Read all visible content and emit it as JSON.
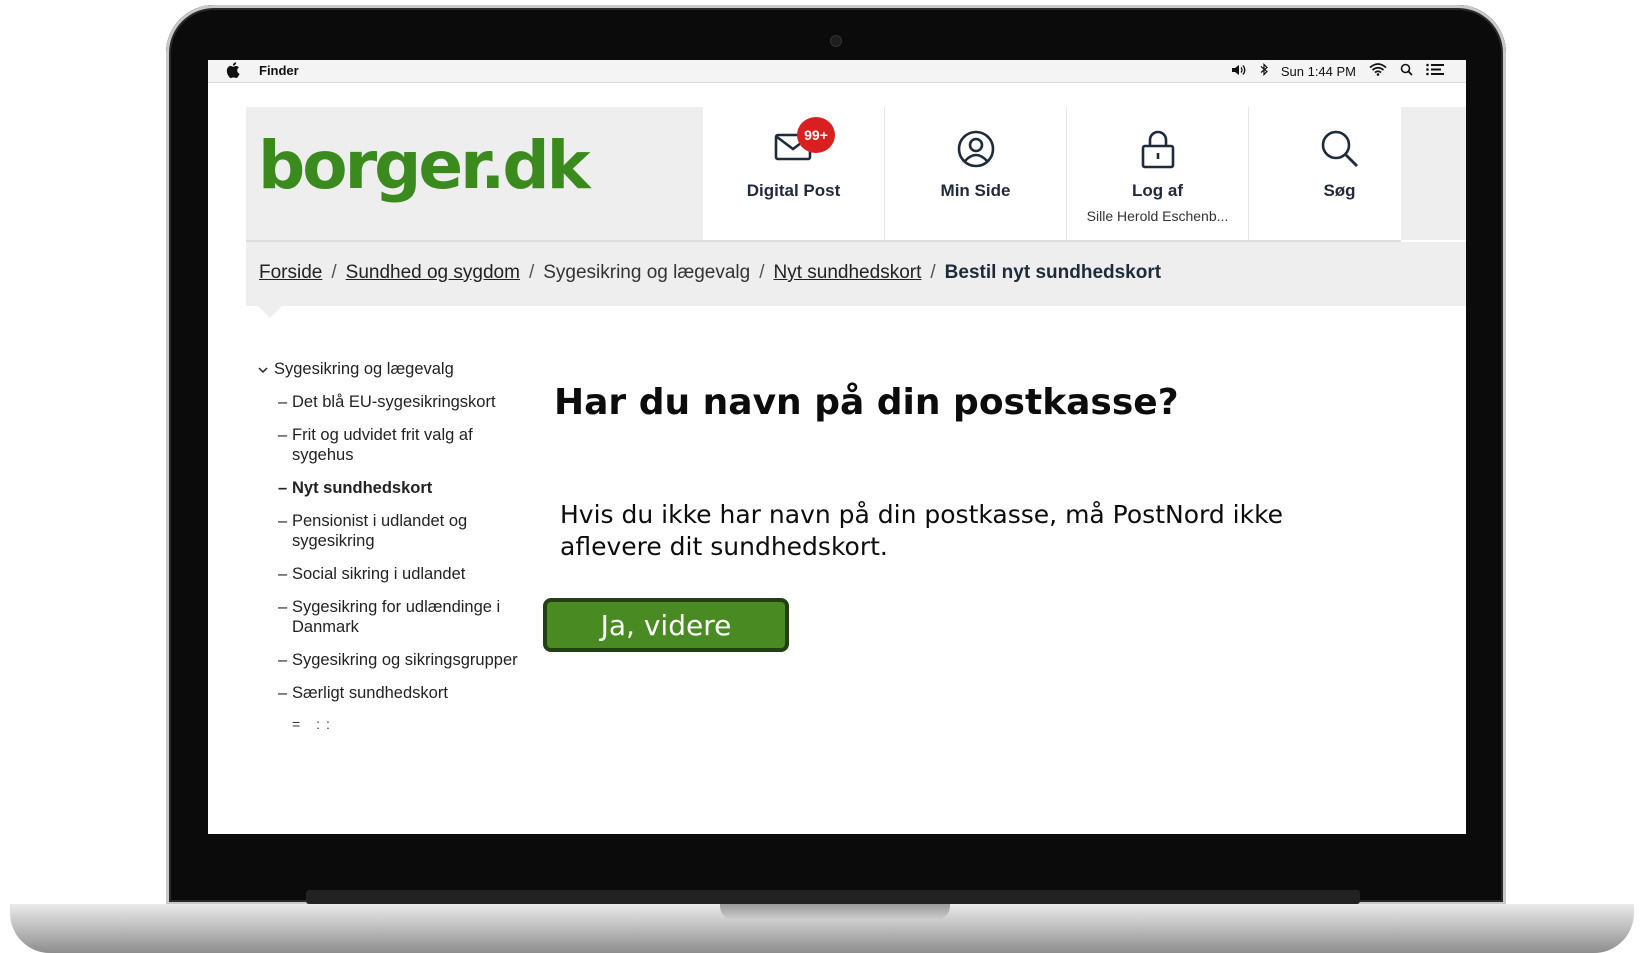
{
  "menubar": {
    "app_name": "Finder",
    "clock": "Sun 1:44 PM"
  },
  "site": {
    "logo": "borger.dk",
    "logo_color": "#3a8a1e",
    "nav": [
      {
        "label": "Digital Post",
        "badge": "99+",
        "icon": "envelope-icon"
      },
      {
        "label": "Min Side",
        "icon": "user-icon"
      },
      {
        "label": "Log af",
        "sub": "Sille Herold Eschenb...",
        "icon": "lock-icon"
      },
      {
        "label": "Søg",
        "icon": "search-icon"
      }
    ]
  },
  "breadcrumb": {
    "items": [
      "Forside",
      "Sundhed og sygdom",
      "Sygesikring og lægevalg",
      "Nyt sundhedskort"
    ],
    "current": "Bestil nyt sundhedskort",
    "separator": "/"
  },
  "sidebar": {
    "parent": "Sygesikring og lægevalg",
    "items": [
      "Det blå EU-sygesikringskort",
      "Frit og udvidet frit valg af sygehus",
      "Nyt sundhedskort",
      "Pensionist i udlandet og sygesikring",
      "Social sikring i udlandet",
      "Sygesikring for udlændinge i Danmark",
      "Sygesikring og sikringsgrupper",
      "Særligt sundhedskort"
    ],
    "active_index": 2,
    "trailing": "=  ::"
  },
  "main": {
    "title": "Har du navn på din postkasse?",
    "body": "Hvis du ikke har navn på din postkasse, må PostNord ikke aflevere dit sundhedskort.",
    "button_label": "Ja, videre",
    "button_color": "#4a8a22"
  }
}
